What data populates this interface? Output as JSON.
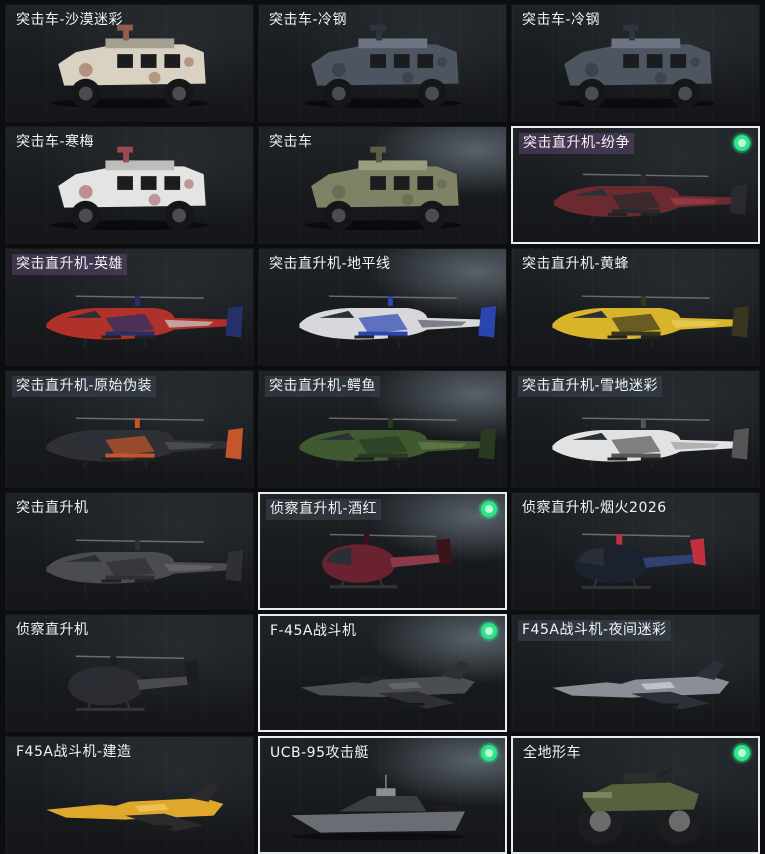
{
  "items": [
    {
      "label": "突击车-沙漠迷彩",
      "kind": "truck",
      "colors": [
        "#d9d2c3",
        "#8f5e4a",
        "#a59f91"
      ],
      "tag": "plain",
      "equipped": false
    },
    {
      "label": "突击车-冷钢",
      "kind": "truck",
      "colors": [
        "#4d5560",
        "#2f353d",
        "#6b7480"
      ],
      "tag": "plain",
      "equipped": false
    },
    {
      "label": "突击车-冷钢",
      "kind": "truck",
      "colors": [
        "#4d5560",
        "#2f353d",
        "#6b7480"
      ],
      "tag": "plain",
      "equipped": false
    },
    {
      "label": "突击车-寒梅",
      "kind": "truck",
      "colors": [
        "#e4e4e2",
        "#9a4a52",
        "#bdbdbb"
      ],
      "tag": "plain",
      "equipped": false
    },
    {
      "label": "突击车",
      "kind": "truck",
      "colors": [
        "#7f8264",
        "#5b5e46",
        "#9a9d7e"
      ],
      "tag": "plain",
      "equipped": false
    },
    {
      "label": "突击直升机-纷争",
      "kind": "heli",
      "colors": [
        "#6a2a30",
        "#2a2a2e",
        "#a0404a"
      ],
      "tag": "purple",
      "equipped": true
    },
    {
      "label": "突击直升机-英雄",
      "kind": "heli",
      "colors": [
        "#b0302a",
        "#25306a",
        "#d0d0d0"
      ],
      "tag": "purple",
      "equipped": false
    },
    {
      "label": "突击直升机-地平线",
      "kind": "heli",
      "colors": [
        "#d8d8dc",
        "#2b45b0",
        "#555a66"
      ],
      "tag": "plain",
      "equipped": false
    },
    {
      "label": "突击直升机-黄蜂",
      "kind": "heli",
      "colors": [
        "#d8b42a",
        "#3a3520",
        "#e8cf60"
      ],
      "tag": "plain",
      "equipped": false
    },
    {
      "label": "突击直升机-原始伪装",
      "kind": "heli",
      "colors": [
        "#2f3036",
        "#c5552a",
        "#55565c"
      ],
      "tag": "tag",
      "equipped": false
    },
    {
      "label": "突击直升机-鳄鱼",
      "kind": "heli",
      "colors": [
        "#3f5a30",
        "#2a3a22",
        "#6a7d4a"
      ],
      "tag": "tag",
      "equipped": false
    },
    {
      "label": "突击直升机-雪地迷彩",
      "kind": "heli",
      "colors": [
        "#e2e2e2",
        "#555555",
        "#a0a0a0"
      ],
      "tag": "tag",
      "equipped": false
    },
    {
      "label": "突击直升机",
      "kind": "heli",
      "colors": [
        "#4a4c50",
        "#2f3033",
        "#6a6c70"
      ],
      "tag": "plain",
      "equipped": false
    },
    {
      "label": "侦察直升机-酒红",
      "kind": "scout",
      "colors": [
        "#6a2230",
        "#3a1218",
        "#8a3a48"
      ],
      "tag": "tag",
      "equipped": true
    },
    {
      "label": "侦察直升机-烟火2026",
      "kind": "scout",
      "colors": [
        "#1c2130",
        "#c03040",
        "#304070"
      ],
      "tag": "plain",
      "equipped": false
    },
    {
      "label": "侦察直升机",
      "kind": "scout",
      "colors": [
        "#2c2d30",
        "#1c1d20",
        "#4a4b4e"
      ],
      "tag": "plain",
      "equipped": false
    },
    {
      "label": "F-45A战斗机",
      "kind": "jet",
      "colors": [
        "#4a4d52",
        "#2e3034",
        "#6a6d72"
      ],
      "tag": "plain",
      "equipped": true
    },
    {
      "label": "F45A战斗机-夜间迷彩",
      "kind": "jet",
      "colors": [
        "#8a8e96",
        "#2c3038",
        "#d0d2d6"
      ],
      "tag": "tag",
      "equipped": false
    },
    {
      "label": "F45A战斗机-建造",
      "kind": "jet",
      "colors": [
        "#e0a82a",
        "#2a2a2a",
        "#f0c860"
      ],
      "tag": "plain",
      "equipped": false
    },
    {
      "label": "UCB-95攻击艇",
      "kind": "boat",
      "colors": [
        "#6a6e74",
        "#3a3d42",
        "#8c9096"
      ],
      "tag": "plain",
      "equipped": true
    },
    {
      "label": "全地形车",
      "kind": "atv",
      "colors": [
        "#56623e",
        "#2c2e2a",
        "#7a8660"
      ],
      "tag": "plain",
      "equipped": true
    }
  ]
}
